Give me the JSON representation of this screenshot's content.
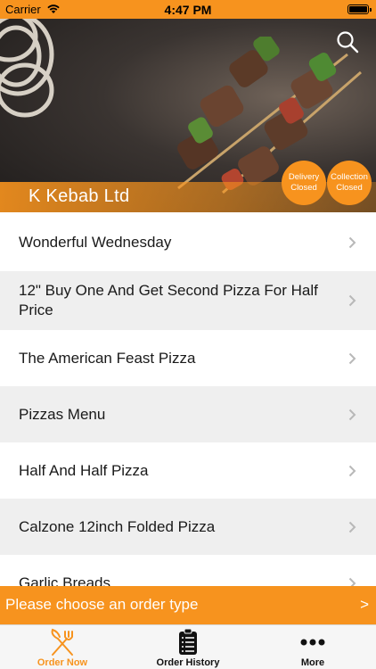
{
  "status_bar": {
    "carrier": "Carrier",
    "time": "4:47 PM"
  },
  "restaurant": {
    "name": "K Kebab Ltd",
    "delivery_line1": "Delivery",
    "delivery_line2": "Closed",
    "collection_line1": "Collection",
    "collection_line2": "Closed"
  },
  "menu": {
    "items": [
      {
        "label": "Wonderful  Wednesday"
      },
      {
        "label": "12\" Buy One And Get Second Pizza For Half Price"
      },
      {
        "label": "The American Feast Pizza"
      },
      {
        "label": "Pizzas Menu"
      },
      {
        "label": "Half And Half Pizza"
      },
      {
        "label": "Calzone 12inch Folded Pizza"
      },
      {
        "label": "Garlic Breads"
      }
    ]
  },
  "order_bar": {
    "label": "Please choose an order type",
    "arrow": ">"
  },
  "tabs": [
    {
      "label": "Order Now",
      "icon": "fork-knife-icon",
      "active": true
    },
    {
      "label": "Order History",
      "icon": "clipboard-icon",
      "active": false
    },
    {
      "label": "More",
      "icon": "more-dots-icon",
      "active": false
    }
  ],
  "colors": {
    "accent": "#f7931e",
    "alt_row": "#efefef",
    "text": "#1a1a1a"
  }
}
